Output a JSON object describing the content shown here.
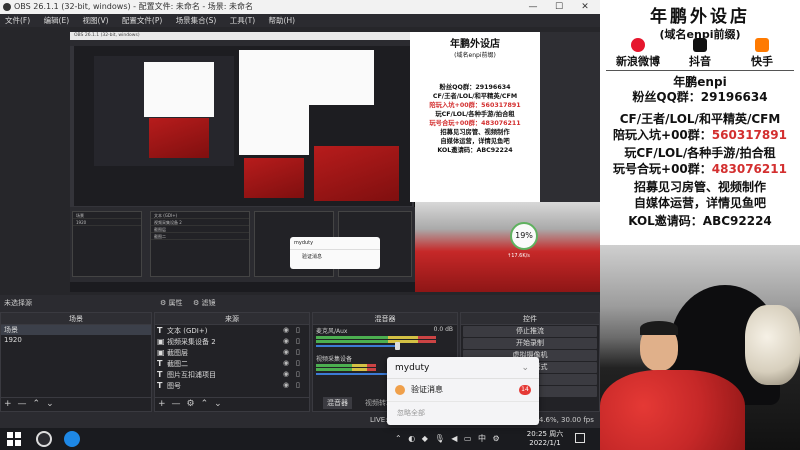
{
  "window": {
    "title": "OBS 26.1.1 (32-bit, windows) - 配置文件: 未命名 - 场景: 未命名",
    "controls": [
      "—",
      "☐",
      "✕"
    ]
  },
  "menu": [
    "文件(F)",
    "编辑(E)",
    "视图(V)",
    "配置文件(P)",
    "场景集合(S)",
    "工具(T)",
    "帮助(H)"
  ],
  "promo": {
    "title": "年鹏外设店",
    "subtitle": "(域名enpi前缀)",
    "social": [
      {
        "label": "新浪微博",
        "icon": "weibo-icon",
        "color": "#e6162d"
      },
      {
        "label": "抖音",
        "icon": "douyin-icon",
        "color": "#111111"
      },
      {
        "label": "快手",
        "icon": "kuaishou-icon",
        "color": "#ff7a00"
      }
    ],
    "name_line": "年鹏enpi",
    "qq_group": "粉丝QQ群：29196634",
    "line1": "CF/王者/LOL/和平精英/CFM",
    "line2_prefix": "陪玩入坑+00群：",
    "line2_value": "560317891",
    "line3": "玩CF/LOL/各种手游/拍合租",
    "line4_prefix": "玩号合玩+00群：",
    "line4_value": "483076211",
    "line5": "招募见习房管、视频制作",
    "line6": "自媒体运营，详情见鱼吧",
    "line7": "KOL邀请码：ABC92224"
  },
  "preview_promo": {
    "title": "年鹏外设店",
    "subtitle": "(域名enpi前缀)",
    "qq": "粉丝QQ群：29196634",
    "l1": "CF/王者/LOL/和平精英/CFM",
    "l2": "陪玩入坑+00群：560317891",
    "l3": "玩CF/LOL/各种手游/拍合租",
    "l4": "玩号合玩+00群：483076211",
    "l5": "招募见习房管、视频制作",
    "l6": "自媒体运营，详情见鱼吧",
    "l7": "KOL邀请码：ABC92224"
  },
  "overlay_pct": "19%",
  "overlay_speed": "↑17.6K/s",
  "status_row": {
    "no_source": "未选择源",
    "properties": "属性",
    "filters": "滤镜"
  },
  "docks": {
    "scenes": {
      "header": "场景",
      "items": [
        "场景",
        "1920"
      ]
    },
    "sources": {
      "header": "来源",
      "items": [
        "文本 (GDI+)",
        "视频采集设备 2",
        "截图层",
        "截图二",
        "图片互扣浦项目",
        "图号"
      ]
    },
    "mixer": {
      "header": "混音器",
      "channels": [
        {
          "name": "麦克风/Aux",
          "level": "0.0 dB"
        },
        {
          "name": "视频采集设备",
          "level": ""
        }
      ],
      "tabs": [
        "混音器",
        "视频转场"
      ]
    },
    "controls": {
      "header": "控件",
      "buttons": [
        "停止推流",
        "开始录制",
        "虚拟摄像机",
        "工作室模式",
        "设置",
        "退出"
      ]
    }
  },
  "status_bar": {
    "live": "LIVE: 00:00:00",
    "rec": "REC: 00:00:00",
    "cpu": "CPU: 4.6%, 30.00 fps"
  },
  "notification": {
    "app": "myduty",
    "item": "验证消息",
    "count": "14",
    "footer": "忽略全部"
  },
  "mini_notification": {
    "app": "myduty",
    "item": "验证消息"
  },
  "tray": {
    "ime": "中",
    "time": "20:25 周六",
    "date": "2022/1/1"
  },
  "colors": {
    "accent_red": "#d32f2f",
    "obs_bg": "#2b2b30"
  }
}
